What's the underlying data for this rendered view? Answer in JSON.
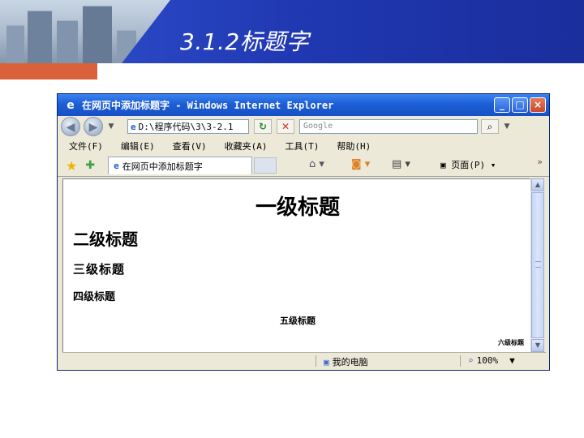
{
  "slide": {
    "title": "3.1.2标题字",
    "colors": {
      "header_blue": "#1a2f9c",
      "accent_orange": "#d9623a"
    }
  },
  "browser": {
    "title": "在网页中添加标题字 - Windows Internet Explorer",
    "address": "D:\\程序代码\\3\\3-2.1",
    "search_placeholder": "Google",
    "menu": [
      "文件(F)",
      "编辑(E)",
      "查看(V)",
      "收藏夹(A)",
      "工具(T)",
      "帮助(H)"
    ],
    "tab_label": "在网页中添加标题字",
    "page_menu": "页面(P)",
    "status_zone": "我的电脑",
    "zoom": "100%"
  },
  "page": {
    "h1": "一级标题",
    "h2": "二级标题",
    "h3": "三级标题",
    "h4": "四级标题",
    "h5": "五级标题",
    "h6": "六级标题"
  },
  "icons": [
    "ie-icon",
    "back-icon",
    "forward-icon",
    "refresh-icon",
    "stop-icon",
    "search-icon",
    "favorites-star-icon",
    "add-favorites-icon",
    "home-icon",
    "feeds-icon",
    "print-icon",
    "page-icon",
    "computer-icon",
    "zoom-icon"
  ]
}
